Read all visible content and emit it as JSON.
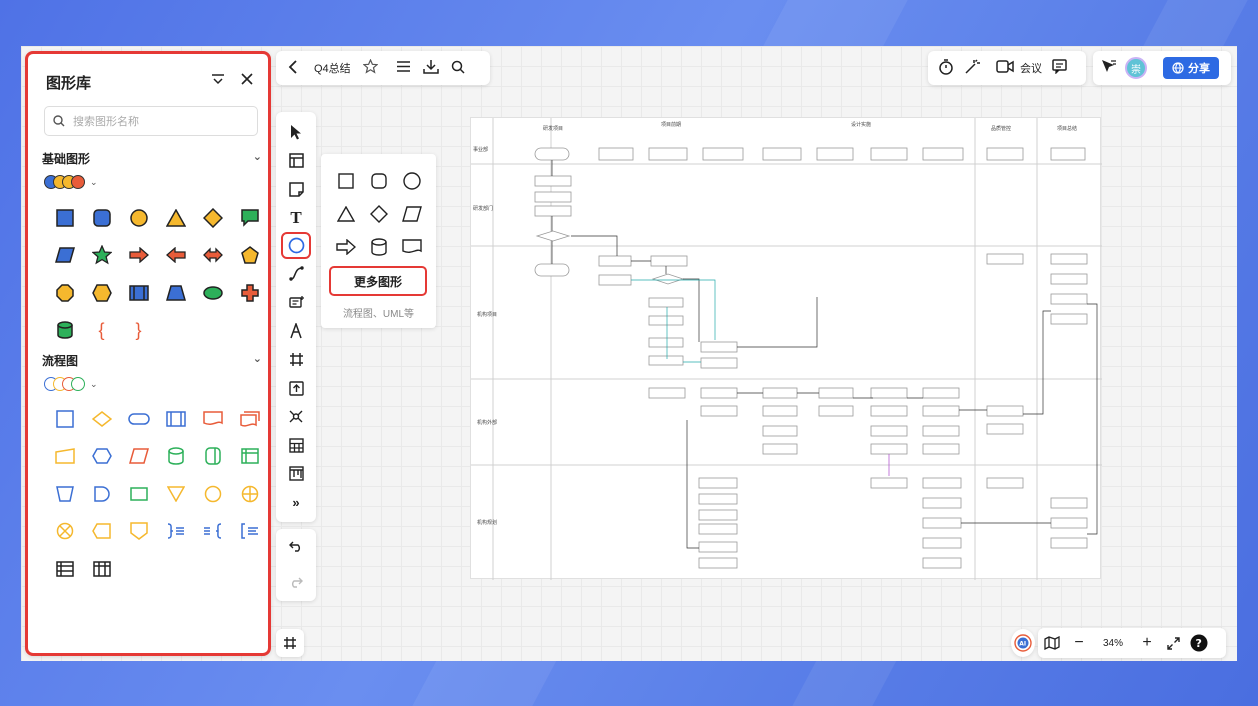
{
  "app": {
    "doc_title": "Q4总结"
  },
  "library": {
    "title": "图形库",
    "search_placeholder": "搜索图形名称",
    "sections": [
      {
        "name": "基础图形",
        "palette_colors": [
          "#3b6fd4",
          "#f5b82e",
          "#f5b82e",
          "#e85c3a"
        ]
      },
      {
        "name": "流程图",
        "palette_colors": [
          "#3b6fd4",
          "#f5b82e",
          "#e85c3a",
          "#2db05a"
        ]
      }
    ]
  },
  "topbar": {
    "meeting_label": "会议",
    "share_label": "分享",
    "avatar_text": "崇"
  },
  "shape_popup": {
    "more_label": "更多图形",
    "sub_label": "流程图、UML等"
  },
  "zoom": {
    "level": "34%"
  },
  "icons": {
    "header": [
      "collapse-icon",
      "close-icon"
    ],
    "topbar": [
      "back-icon",
      "star-icon",
      "menu-icon",
      "download-icon",
      "search-icon"
    ],
    "rightbar": [
      "timer-icon",
      "magic-wand-icon",
      "video-icon",
      "comment-icon",
      "cursor-follow-icon",
      "globe-icon"
    ],
    "tools": [
      "select-icon",
      "template-icon",
      "sticky-note-icon",
      "text-icon",
      "shape-icon",
      "connector-icon",
      "ai-text-icon",
      "pen-icon",
      "frame-icon",
      "upload-icon",
      "mindmap-icon",
      "table-icon",
      "kanban-icon",
      "more-icon"
    ],
    "bottom": [
      "undo-icon",
      "redo-icon",
      "frame-icon",
      "ai-icon",
      "map-icon",
      "zoom-out-icon",
      "zoom-in-icon",
      "fullscreen-icon",
      "help-icon"
    ]
  },
  "colors": {
    "accent": "#2d6ae3",
    "highlight": "#e53935"
  }
}
